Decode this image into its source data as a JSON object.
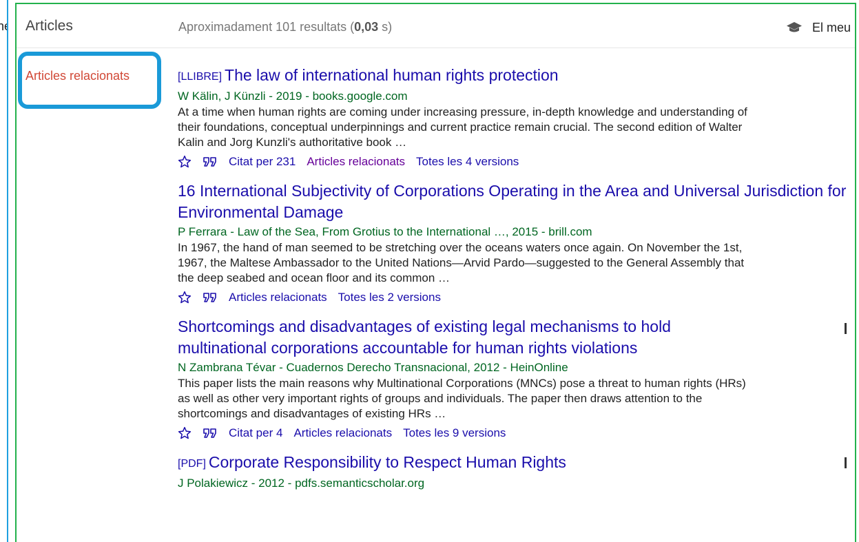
{
  "left_panel": {
    "text": "ne"
  },
  "header": {
    "title": "Articles",
    "stats_prefix": "Aproximadament 101 resultats (",
    "stats_time": "0,03",
    "stats_suffix": " s)",
    "library_label": "El meu"
  },
  "sidebar": {
    "related_link": "Articles relacionats"
  },
  "results": [
    {
      "tag": "[LLIBRE]",
      "title": "The law of international human rights protection",
      "authors": "W Kälin, J Künzli - 2019 - books.google.com",
      "snippet": "At a time when human rights are coming under increasing pressure, in-depth knowledge and understanding of their foundations, conceptual underpinnings and current practice remain crucial. The second edition of Walter Kalin and Jorg Kunzli's authoritative book …",
      "cited": "Citat per 231",
      "related": "Articles relacionats",
      "versions": "Totes les 4 versions"
    },
    {
      "tag": "",
      "title": "16 International Subjectivity of Corporations Operating in the Area and Universal Jurisdiction for Environmental Damage",
      "authors": "P Ferrara - Law of the Sea, From Grotius to the International …, 2015 - brill.com",
      "snippet": "In 1967, the hand of man seemed to be stretching over the oceans waters once again. On November the 1st, 1967, the Maltese Ambassador to the United Nations—Arvid Pardo—suggested to the General Assembly that the deep seabed and ocean floor and its common …",
      "cited": "",
      "related": "Articles relacionats",
      "versions": "Totes les 2 versions"
    },
    {
      "tag": "",
      "title": "Shortcomings and disadvantages of existing legal mechanisms to hold multinational corporations accountable for human rights violations",
      "authors": "N Zambrana Tévar - Cuadernos Derecho Transnacional, 2012 - HeinOnline",
      "snippet": "This paper lists the main reasons why Multinational Corporations (MNCs) pose a threat to human rights (HRs) as well as other very important rights of groups and individuals. The paper then draws attention to the shortcomings and disadvantages of existing HRs …",
      "cited": "Citat per 4",
      "related": "Articles relacionats",
      "versions": "Totes les 9 versions"
    },
    {
      "tag": "[PDF]",
      "title": "Corporate Responsibility to Respect Human Rights",
      "authors": "J Polakiewicz - 2012 - pdfs.semanticscholar.org"
    }
  ],
  "icons": {
    "save": "star-icon",
    "cite": "quote-icon",
    "library": "graduation-cap-icon"
  },
  "colors": {
    "link": "#1a0dab",
    "visited": "#660099",
    "authors": "#006621",
    "sidebar_link": "#d14836",
    "highlight": "#1a9ad8",
    "frame": "#22b14c"
  }
}
